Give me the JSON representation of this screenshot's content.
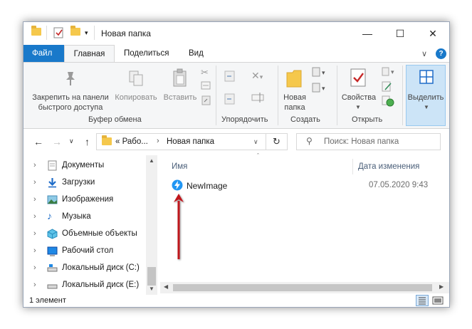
{
  "window": {
    "title": "Новая папка",
    "minimize_glyph": "—",
    "maximize_glyph": "☐",
    "close_glyph": "✕"
  },
  "ribbon_tabs": [
    {
      "label": "Файл"
    },
    {
      "label": "Главная"
    },
    {
      "label": "Поделиться"
    },
    {
      "label": "Вид"
    }
  ],
  "ribbon": {
    "pin_label": "Закрепить на панели\nбыстрого доступа",
    "copy_label": "Копировать",
    "paste_label": "Вставить",
    "clipboard_group": "Буфер обмена",
    "organize_group": "Упорядочить",
    "new_folder_label": "Новая\nпапка",
    "create_group": "Создать",
    "properties_label": "Свойства",
    "open_group": "Открыть",
    "select_label": "Выделить"
  },
  "address": {
    "crumb_root": "«  Рабо...",
    "crumb_current": "Новая папка",
    "search_placeholder": "Поиск: Новая папка"
  },
  "nav_items": [
    {
      "label": "Документы",
      "icon": "documents-icon"
    },
    {
      "label": "Загрузки",
      "icon": "downloads-icon"
    },
    {
      "label": "Изображения",
      "icon": "pictures-icon"
    },
    {
      "label": "Музыка",
      "icon": "music-icon"
    },
    {
      "label": "Объемные объекты",
      "icon": "3d-objects-icon"
    },
    {
      "label": "Рабочий стол",
      "icon": "desktop-icon"
    },
    {
      "label": "Локальный диск (C:)",
      "icon": "drive-icon"
    },
    {
      "label": "Локальный диск (E:)",
      "icon": "drive-icon"
    }
  ],
  "columns": {
    "name": "Имя",
    "date": "Дата изменения"
  },
  "files": [
    {
      "name": "NewImage",
      "date": "07.05.2020 9:43",
      "icon": "lightning-app-icon"
    }
  ],
  "status": {
    "count": "1 элемент"
  },
  "colors": {
    "file_tab": "#1979ca",
    "arrow": "#c0141e",
    "folder": "#f5c84c"
  }
}
